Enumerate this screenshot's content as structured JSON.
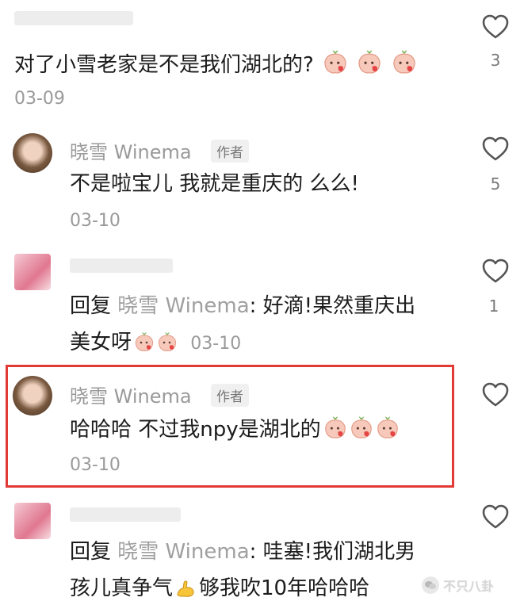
{
  "comment1": {
    "text": "对了小雪老家是不是我们湖北的?",
    "date": "03-09",
    "likes": "3"
  },
  "comment2": {
    "author": "晓雪 Winema",
    "badge": "作者",
    "text": "不是啦宝儿 我就是重庆的 么么!",
    "date": "03-10",
    "likes": "5"
  },
  "comment3": {
    "reply_prefix": "回复",
    "reply_to": "晓雪 Winema",
    "text_line1": ": 好滴!果然重庆出",
    "text_line2": "美女呀",
    "date": "03-10",
    "likes": "1"
  },
  "comment4": {
    "author": "晓雪 Winema",
    "badge": "作者",
    "text": "哈哈哈 不过我npy是湖北的",
    "date": "03-10",
    "highlight_color": "#e23a35"
  },
  "comment5": {
    "reply_prefix": "回复",
    "reply_to": "晓雪 Winema",
    "text_line1": ": 哇塞!我们湖北男",
    "text_line2a": "孩儿真争气",
    "text_line2b": "够我吹10年哈哈哈"
  },
  "watermark": {
    "text": "不只八卦"
  },
  "icons": {
    "like": "heart-outline-icon",
    "emoji": "peach-face-emoji",
    "arm": "flexed-biceps-emoji"
  }
}
